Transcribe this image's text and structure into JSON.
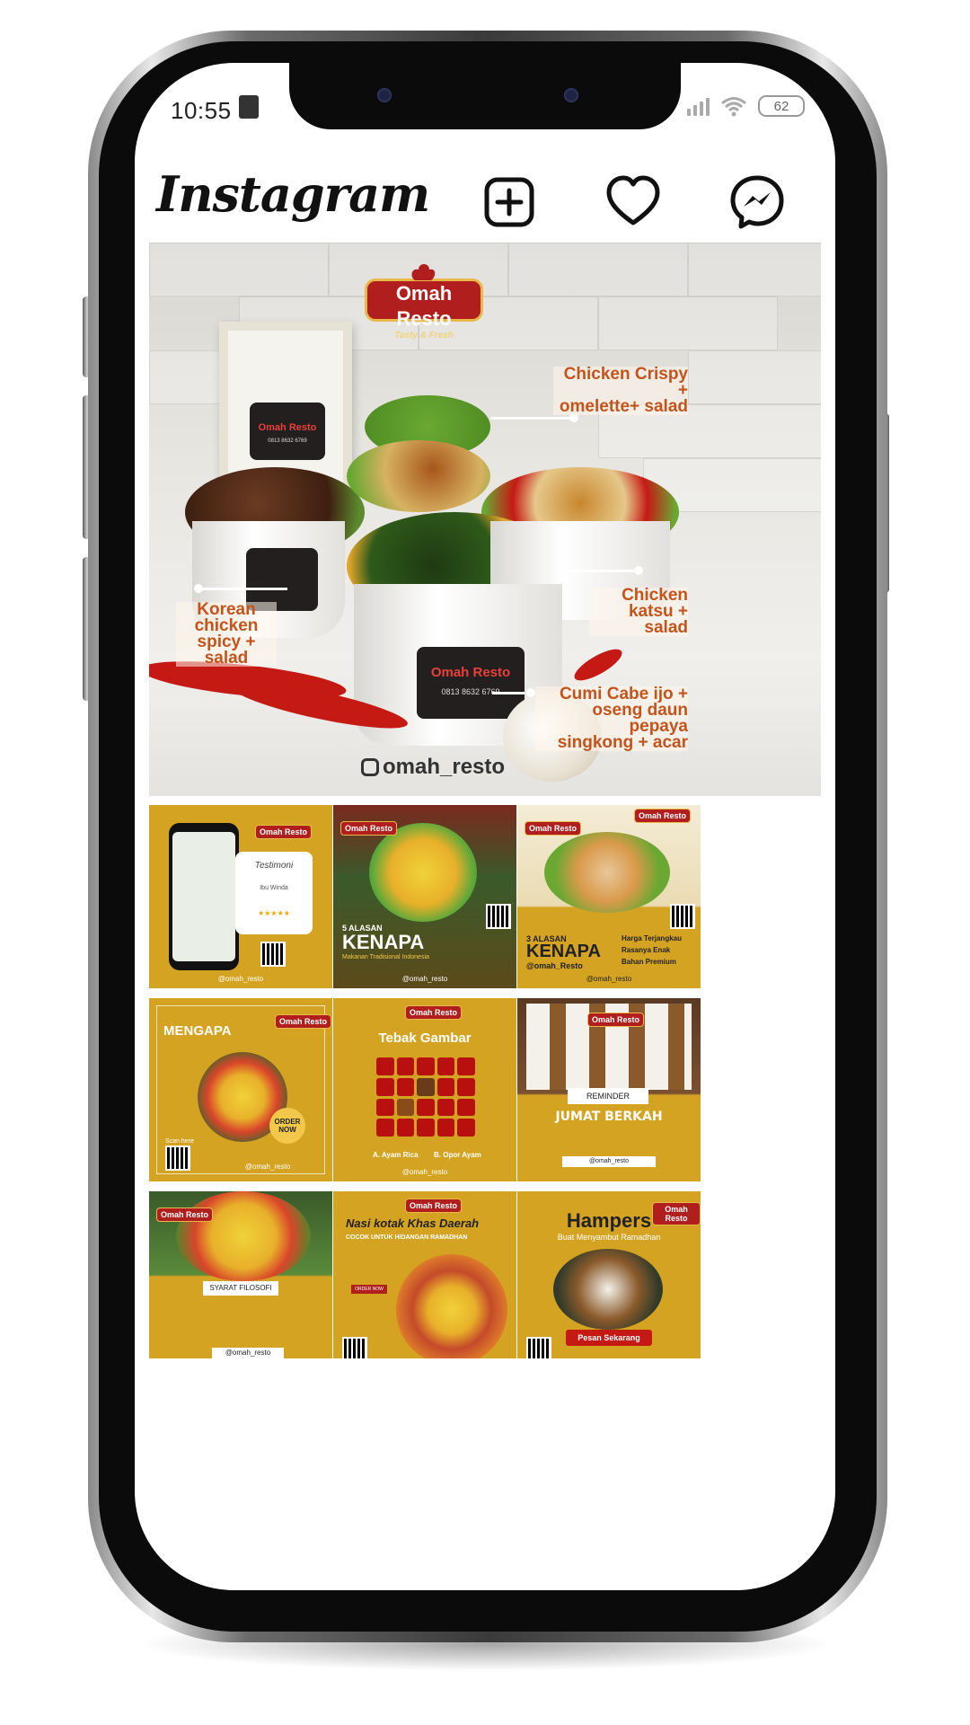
{
  "status": {
    "time": "10:55",
    "battery": "62"
  },
  "app": {
    "name": "Instagram"
  },
  "hero": {
    "brand": "Omah Resto",
    "tagline": "Tasty & Fresh",
    "phone": "0813 8632 6769",
    "handle": "omah_resto",
    "callouts": [
      {
        "line1": "Chicken Crispy +",
        "line2": "omelette+ salad",
        "line3": ""
      },
      {
        "line1": "Korean chicken",
        "line2": "spicy + salad",
        "line3": ""
      },
      {
        "line1": "Chicken",
        "line2": "katsu + salad",
        "line3": ""
      },
      {
        "line1": "Cumi Cabe ijo +",
        "line2": "oseng daun pepaya",
        "line3": "singkong + acar"
      }
    ]
  },
  "grid": {
    "handle": "@omah_resto",
    "tiles": [
      {
        "title": "",
        "subtitle": "Testimoni",
        "name": "Ibu Winda"
      },
      {
        "title": "5 ALASAN",
        "subtitle": "KENAPA",
        "name": "Makanan Tradisional Indonesia"
      },
      {
        "title": "3 ALASAN",
        "subtitle": "KENAPA",
        "name": "@omah_Resto",
        "items": [
          "Harga Terjangkau",
          "Rasanya Enak",
          "Bahan Premium"
        ]
      },
      {
        "title": "MENGAPA",
        "subtitle": "ORDER NOW",
        "name": "Scan here"
      },
      {
        "title": "Tebak Gambar",
        "subtitle": "A. Ayam Rica",
        "name": "B. Opor Ayam"
      },
      {
        "title": "REMINDER",
        "subtitle": "JUMAT BERKAH",
        "name": "@omah_resto"
      },
      {
        "title": "SYARAT FILOSOFI",
        "subtitle": "",
        "name": "@omah_resto"
      },
      {
        "title": "Nasi kotak Khas Daerah",
        "subtitle": "COCOK UNTUK HIDANGAN RAMADHAN",
        "name": "ORDER NOW"
      },
      {
        "title": "Hampers",
        "subtitle": "Buat Menyambut Ramadhan",
        "name": "Pesan Sekarang"
      }
    ]
  },
  "colors": {
    "mustard": "#d4a322",
    "brand_red": "#b01e1e",
    "callout": "#c2541c"
  }
}
